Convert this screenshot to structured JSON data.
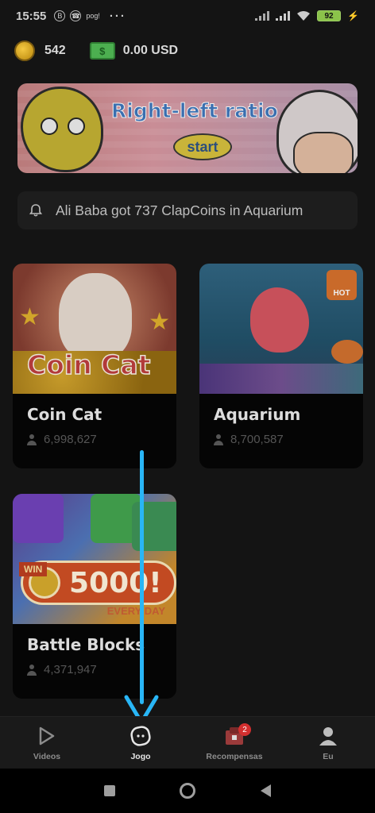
{
  "status_bar": {
    "time": "15:55",
    "b_icon": "B",
    "extra_text": "pog!",
    "more": "···",
    "battery": "92"
  },
  "balance": {
    "coins": "542",
    "usd": "0.00 USD",
    "cash_symbol": "$"
  },
  "banner": {
    "title": "Right-left ratio",
    "start_label": "start"
  },
  "notification": {
    "text": "Ali Baba got 737 ClapCoins in Aquarium"
  },
  "games": [
    {
      "title": "Coin Cat",
      "players": "6,998,627",
      "art_label": "Coin Cat"
    },
    {
      "title": "Aquarium",
      "players": "8,700,587",
      "badge": "HOT"
    },
    {
      "title": "Battle Blocks",
      "players": "4,371,947",
      "art_win": "WIN",
      "art_amount": "5000!",
      "art_every": "EVERY DAY"
    }
  ],
  "bottom_nav": [
    {
      "label": "Videos",
      "icon": "play-icon"
    },
    {
      "label": "Jogo",
      "icon": "game-icon",
      "active": true
    },
    {
      "label": "Recompensas",
      "icon": "gift-icon",
      "badge": "2"
    },
    {
      "label": "Eu",
      "icon": "profile-icon"
    }
  ],
  "colors": {
    "background": "#141414",
    "arrow": "#29b6f6",
    "badge": "#d32f2f"
  }
}
